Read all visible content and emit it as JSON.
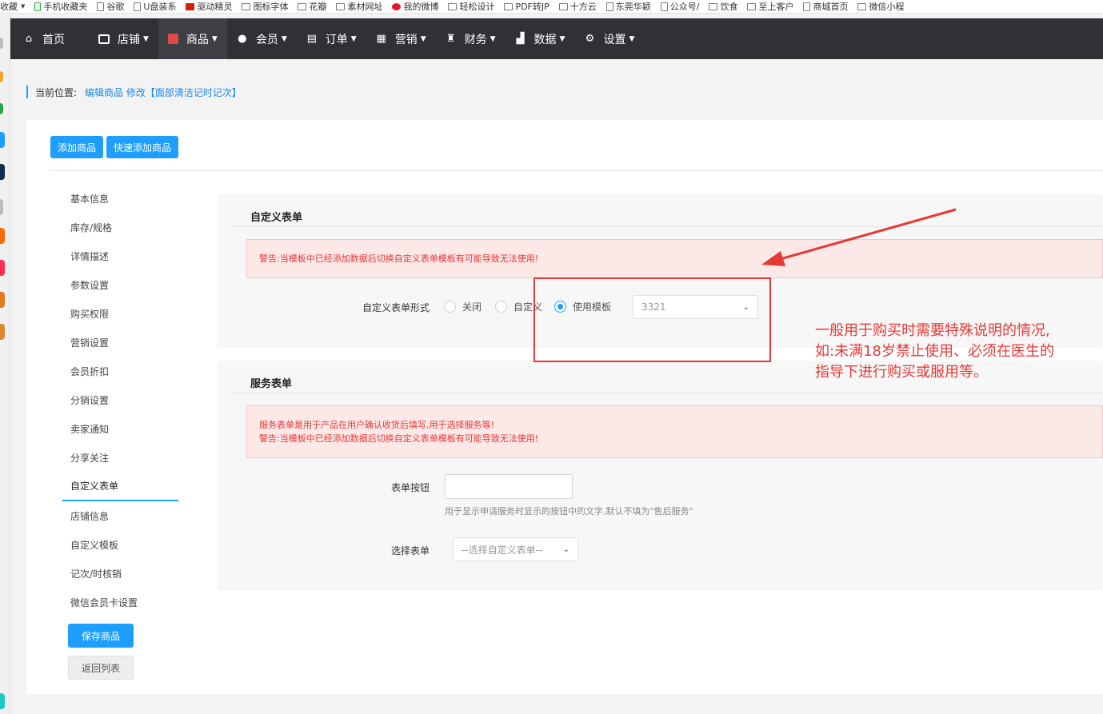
{
  "bookmarks": [
    {
      "label": "收藏",
      "icon": "none"
    },
    {
      "label": "手机收藏夹",
      "icon": "phone"
    },
    {
      "label": "谷歌",
      "icon": "page"
    },
    {
      "label": "U盘装系",
      "icon": "page"
    },
    {
      "label": "驱动精灵",
      "icon": "red"
    },
    {
      "label": "图标字体",
      "icon": "folder"
    },
    {
      "label": "花瓣",
      "icon": "folder"
    },
    {
      "label": "素材网址",
      "icon": "folder"
    },
    {
      "label": "我的微博",
      "icon": "weibo"
    },
    {
      "label": "轻松设计",
      "icon": "folder"
    },
    {
      "label": "PDF转JP",
      "icon": "folder"
    },
    {
      "label": "十方云",
      "icon": "folder"
    },
    {
      "label": "东莞华颖",
      "icon": "page"
    },
    {
      "label": "公众号/",
      "icon": "page"
    },
    {
      "label": "饮食",
      "icon": "folder"
    },
    {
      "label": "至上客户",
      "icon": "folder"
    },
    {
      "label": "商城首页",
      "icon": "page"
    },
    {
      "label": "微信小程",
      "icon": "folder"
    }
  ],
  "nav": {
    "home": "首页",
    "items": [
      {
        "label": "店铺",
        "icon": "store-icon",
        "active": false
      },
      {
        "label": "商品",
        "icon": "goods-icon",
        "active": true
      },
      {
        "label": "会员",
        "icon": "user-icon",
        "active": false
      },
      {
        "label": "订单",
        "icon": "order-icon",
        "active": false
      },
      {
        "label": "营销",
        "icon": "gift-icon",
        "active": false
      },
      {
        "label": "财务",
        "icon": "money-bag-icon",
        "active": false
      },
      {
        "label": "数据",
        "icon": "chart-icon",
        "active": false
      },
      {
        "label": "设置",
        "icon": "gear-icon",
        "active": false
      }
    ]
  },
  "breadcrumb": {
    "label": "当前位置:",
    "path": "编辑商品 修改【面部清洁记时记次】"
  },
  "toolbar": {
    "add_goods": "添加商品",
    "quick_add_goods": "快速添加商品"
  },
  "sidebar": {
    "items": [
      "基本信息",
      "库存/规格",
      "详情描述",
      "参数设置",
      "购买权限",
      "营销设置",
      "会员折扣",
      "分销设置",
      "卖家通知",
      "分享关注",
      "自定义表单",
      "店铺信息",
      "自定义模板",
      "记次/时核销",
      "微信会员卡设置"
    ],
    "active": "自定义表单",
    "save_label": "保存商品",
    "back_label": "返回列表"
  },
  "custom_form": {
    "title": "自定义表单",
    "warning": "警告:当模板中已经添加数据后切换自定义表单模板有可能导致无法使用!",
    "field_label": "自定义表单形式",
    "options": [
      "关闭",
      "自定义",
      "使用模板"
    ],
    "selected_option": "使用模板",
    "template_value": "3321"
  },
  "service_form": {
    "title": "服务表单",
    "notice_line1": "服务表单是用于产品在用户确认收货后填写,用于选择服务等!",
    "notice_line2": "警告:当模板中已经添加数据后切换自定义表单模板有可能导致无法使用!",
    "button_label": "表单按钮",
    "button_value": "",
    "button_hint": "用于显示申请服务时显示的按钮中的文字,默认不填为\"售后服务\"",
    "select_label": "选择表单",
    "select_placeholder": "--选择自定义表单--"
  },
  "annotation": {
    "line1": "一般用于购买时需要特殊说明的情况,",
    "line2": "如:未满18岁禁止使用、必须在医生的",
    "line3": "指导下进行购买或服用等。",
    "color": "#e53935"
  }
}
